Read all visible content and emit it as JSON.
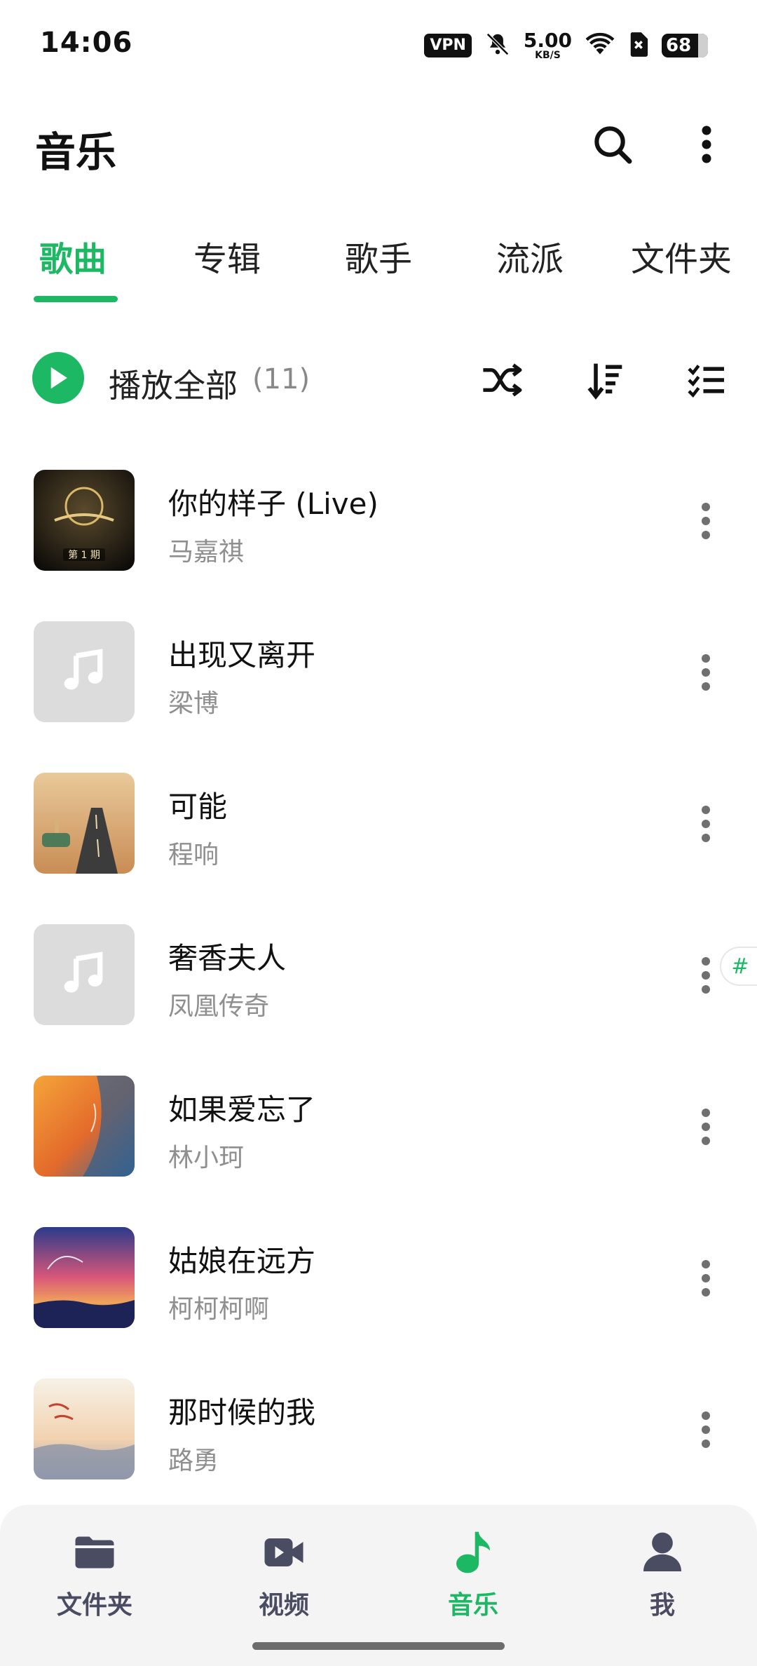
{
  "status_bar": {
    "time": "14:06",
    "vpn": "VPN",
    "speed_value": "5.00",
    "speed_unit": "KB/S",
    "battery": "68"
  },
  "header": {
    "title": "音乐"
  },
  "tabs": [
    {
      "label": "歌曲",
      "active": true
    },
    {
      "label": "专辑",
      "active": false
    },
    {
      "label": "歌手",
      "active": false
    },
    {
      "label": "流派",
      "active": false
    },
    {
      "label": "文件夹",
      "active": false
    }
  ],
  "play_all": {
    "label": "播放全部",
    "count": "(11)"
  },
  "songs": [
    {
      "title": "你的样子 (Live)",
      "artist": "马嘉祺",
      "cover_label": "第 1 期"
    },
    {
      "title": "出现又离开",
      "artist": "梁博"
    },
    {
      "title": "可能",
      "artist": "程响"
    },
    {
      "title": "奢香夫人",
      "artist": "凤凰传奇"
    },
    {
      "title": "如果爱忘了",
      "artist": "林小珂"
    },
    {
      "title": "姑娘在远方",
      "artist": "柯柯柯啊"
    },
    {
      "title": "那时候的我",
      "artist": "路勇"
    }
  ],
  "index_bubble": "#",
  "bottom_nav": [
    {
      "label": "文件夹",
      "icon": "folder-icon",
      "active": false
    },
    {
      "label": "视频",
      "icon": "video-icon",
      "active": false
    },
    {
      "label": "音乐",
      "icon": "music-note-icon",
      "active": true
    },
    {
      "label": "我",
      "icon": "person-icon",
      "active": false
    }
  ],
  "colors": {
    "accent": "#1db863",
    "nav_inactive": "#4a4d62",
    "secondary_text": "#8f8f8f"
  }
}
